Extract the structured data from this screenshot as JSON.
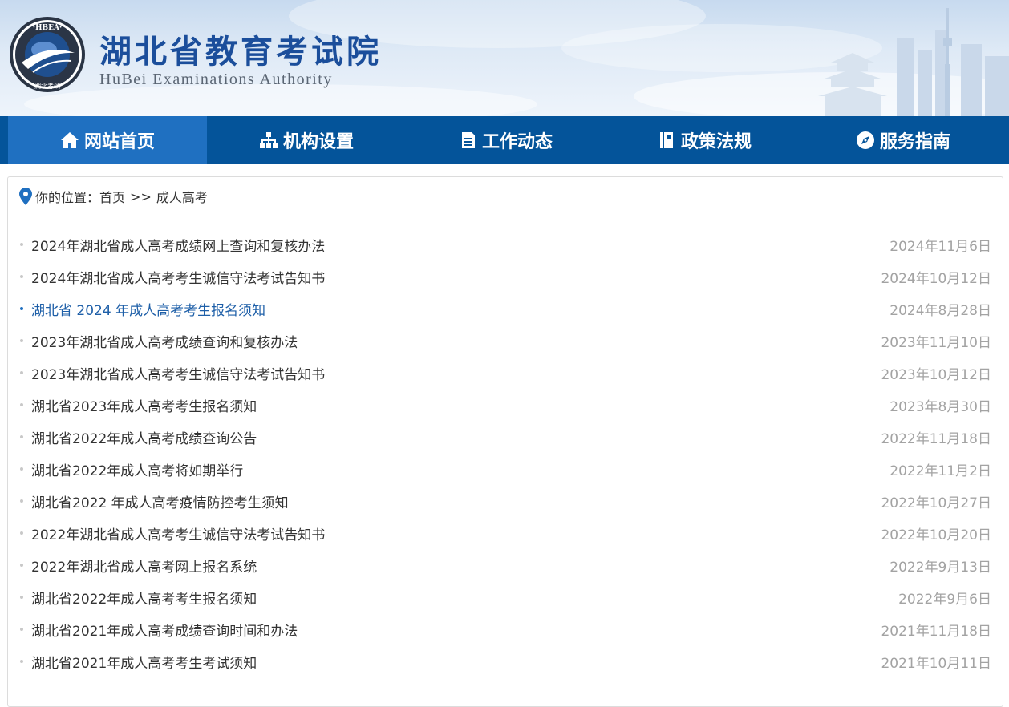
{
  "header": {
    "title_cn": "湖北省教育考试院",
    "title_en": "HuBei Examinations Authority",
    "seal_text_top": "HBEA",
    "seal_text_bottom": "湖北考试"
  },
  "nav": [
    {
      "label": "网站首页",
      "icon": "home-icon"
    },
    {
      "label": "机构设置",
      "icon": "sitemap-icon"
    },
    {
      "label": "工作动态",
      "icon": "news-icon"
    },
    {
      "label": "政策法规",
      "icon": "book-icon"
    },
    {
      "label": "服务指南",
      "icon": "compass-icon"
    }
  ],
  "breadcrumb": {
    "prefix": "你的位置：",
    "home": "首页",
    "separator": ">>",
    "current": "成人高考"
  },
  "articles": [
    {
      "title": "2024年湖北省成人高考成绩网上查询和复核办法",
      "date": "2024年11月6日"
    },
    {
      "title": "2024年湖北省成人高考考生诚信守法考试告知书",
      "date": "2024年10月12日"
    },
    {
      "title": "湖北省 2024 年成人高考考生报名须知",
      "date": "2024年8月28日"
    },
    {
      "title": "2023年湖北省成人高考成绩查询和复核办法",
      "date": "2023年11月10日"
    },
    {
      "title": "2023年湖北省成人高考考生诚信守法考试告知书",
      "date": "2023年10月12日"
    },
    {
      "title": "湖北省2023年成人高考考生报名须知",
      "date": "2023年8月30日"
    },
    {
      "title": "湖北省2022年成人高考成绩查询公告",
      "date": "2022年11月18日"
    },
    {
      "title": "湖北省2022年成人高考将如期举行",
      "date": "2022年11月2日"
    },
    {
      "title": "湖北省2022 年成人高考疫情防控考生须知",
      "date": "2022年10月27日"
    },
    {
      "title": "2022年湖北省成人高考考生诚信守法考试告知书",
      "date": "2022年10月20日"
    },
    {
      "title": "2022年湖北省成人高考网上报名系统",
      "date": "2022年9月13日"
    },
    {
      "title": "湖北省2022年成人高考考生报名须知",
      "date": "2022年9月6日"
    },
    {
      "title": "湖北省2021年成人高考成绩查询时间和办法",
      "date": "2021年11月18日"
    },
    {
      "title": "湖北省2021年成人高考考生考试须知",
      "date": "2021年10月11日"
    }
  ],
  "colors": {
    "nav_bg": "#04549a",
    "nav_active": "#1f70c1",
    "title_blue": "#1b4e9b",
    "link_active": "#1e5fa8",
    "date_gray": "#a3a3a3"
  }
}
